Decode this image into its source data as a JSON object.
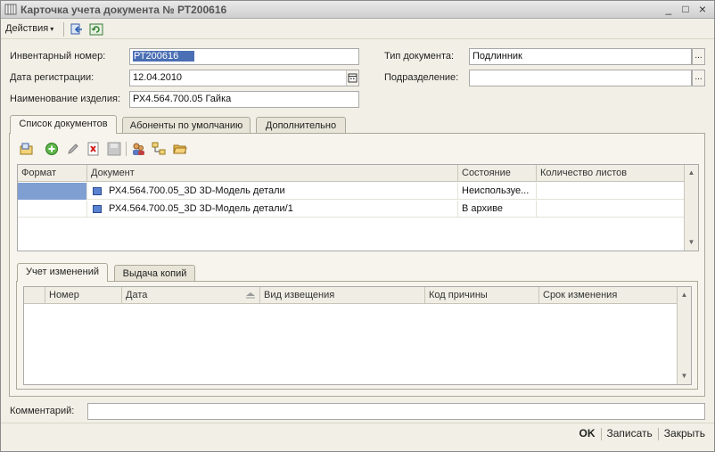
{
  "window": {
    "title": "Карточка учета документа № РТ200616",
    "minimize": "_",
    "maximize": "□",
    "close": "×"
  },
  "toolbar": {
    "actions_label": "Действия",
    "actions_arrow": "▾"
  },
  "form": {
    "inventory_label": "Инвентарный номер:",
    "inventory_value": "РТ200616",
    "reg_date_label": "Дата регистрации:",
    "reg_date_value": "12.04.2010",
    "product_label": "Наименование изделия:",
    "product_value": "РХ4.564.700.05 Гайка",
    "doc_type_label": "Тип документа:",
    "doc_type_value": "Подлинник",
    "department_label": "Подразделение:",
    "department_value": "",
    "ellipsis": "..."
  },
  "tabs": [
    {
      "label": "Список документов",
      "active": true
    },
    {
      "label": "Абоненты по умолчанию",
      "active": false
    },
    {
      "label": "Дополнительно",
      "active": false
    }
  ],
  "documents_table": {
    "columns": [
      "Формат",
      "Документ",
      "Состояние",
      "Количество листов"
    ],
    "rows": [
      {
        "format": "",
        "document": "РХ4.564.700.05_3D 3D-Модель детали",
        "state": "Неиспользуе...",
        "sheets": ""
      },
      {
        "format": "",
        "document": "РХ4.564.700.05_3D 3D-Модель детали/1",
        "state": "В архиве",
        "sheets": ""
      }
    ]
  },
  "sub_tabs": [
    {
      "label": "Учет изменений",
      "active": true
    },
    {
      "label": "Выдача копий",
      "active": false
    }
  ],
  "changes_table": {
    "columns": [
      "Номер",
      "Дата",
      "Вид извещения",
      "Код причины",
      "Срок изменения"
    ],
    "rows": []
  },
  "comment": {
    "label": "Комментарий:",
    "value": ""
  },
  "footer": {
    "ok": "OK",
    "save": "Записать",
    "close": "Закрыть"
  },
  "scroll": {
    "up": "▲",
    "down": "▼"
  }
}
